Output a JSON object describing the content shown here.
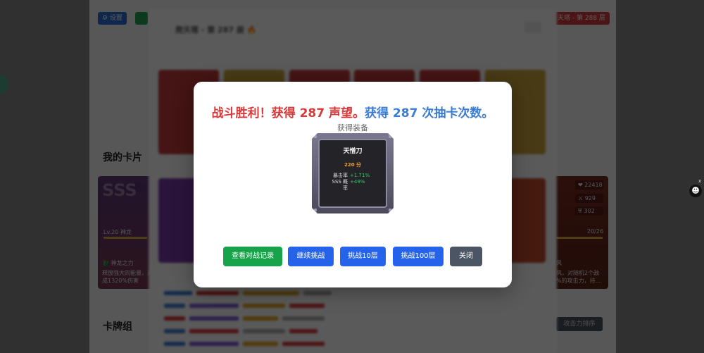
{
  "background": {
    "toolbar": {
      "settings_label": "⚙ 设置",
      "right_badge": "天塔 - 第 288 层"
    },
    "my_cards_heading": "我的卡片",
    "deck_heading": "卡牌组",
    "card_sss_label": "SSS",
    "card_level": "Lv.20 神龙",
    "card_skill_name": "🐉 神龙之力",
    "card_desc_1": "释放强大的能量，对",
    "card_desc_2": "成1320%伤害",
    "right_card_progress": "20/26",
    "right_card_desc_1": "风",
    "right_card_desc_2": "风，对随机2个敌",
    "right_card_desc_3": "%的攻击力，持...",
    "stats": [
      "❤ 22418",
      "⚔ 929",
      "⛨ 302"
    ],
    "sort_button": "攻击力排序",
    "middle_modal_title": "爬天塔 - 第 287 层 🔥"
  },
  "dialog": {
    "title_part1": "战斗胜利！",
    "title_part2": "获得 287 声望。",
    "title_part3": "获得 287 次抽卡次数。",
    "equip_label": "获得装备",
    "equip": {
      "name": "天憎刀",
      "score": "220 分",
      "stats": [
        {
          "key": "暴击率",
          "value": "+1.71%"
        },
        {
          "key": "SSS 概",
          "value": "+49%"
        },
        {
          "key": "率",
          "value": ""
        }
      ]
    },
    "buttons": {
      "view_log": "查看对战记录",
      "continue": "继续挑战",
      "challenge10": "挑战10层",
      "challenge100": "挑战100层",
      "close": "关闭"
    }
  },
  "colors": {
    "victory_red": "#d93838",
    "reward_blue": "#3a7bd5",
    "green_button": "#16a34a",
    "blue_button": "#2563eb",
    "gray_button": "#4b5563"
  },
  "icons": [
    "settings-icon",
    "fire-icon",
    "dragon-icon",
    "heart-icon",
    "sword-icon",
    "shield-icon",
    "robot-icon"
  ]
}
